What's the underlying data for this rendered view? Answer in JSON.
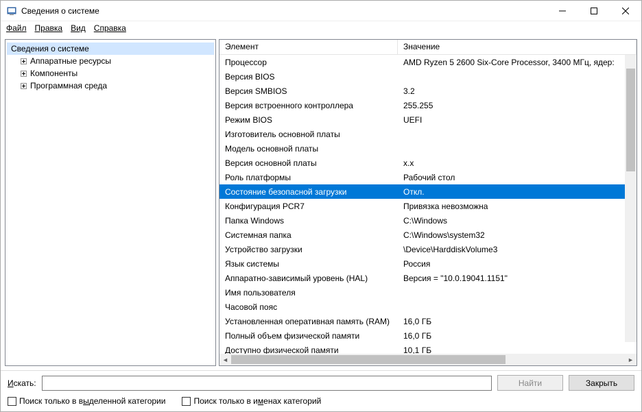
{
  "window": {
    "title": "Сведения о системе"
  },
  "menu": {
    "file": "Файл",
    "edit": "Правка",
    "view": "Вид",
    "help": "Справка"
  },
  "tree": {
    "root": "Сведения о системе",
    "items": [
      "Аппаратные ресурсы",
      "Компоненты",
      "Программная среда"
    ]
  },
  "list": {
    "header_element": "Элемент",
    "header_value": "Значение",
    "rows": [
      {
        "element": "Процессор",
        "value": "AMD Ryzen 5 2600 Six-Core Processor, 3400 МГц, ядер:"
      },
      {
        "element": "Версия BIOS",
        "value": ""
      },
      {
        "element": "Версия SMBIOS",
        "value": "3.2"
      },
      {
        "element": "Версия встроенного контроллера",
        "value": "255.255"
      },
      {
        "element": "Режим BIOS",
        "value": "UEFI"
      },
      {
        "element": "Изготовитель основной платы",
        "value": ""
      },
      {
        "element": "Модель основной платы",
        "value": ""
      },
      {
        "element": "Версия основной платы",
        "value": "х.х"
      },
      {
        "element": "Роль платформы",
        "value": "Рабочий стол"
      },
      {
        "element": "Состояние безопасной загрузки",
        "value": "Откл.",
        "selected": true
      },
      {
        "element": "Конфигурация PCR7",
        "value": "Привязка невозможна"
      },
      {
        "element": "Папка Windows",
        "value": "C:\\Windows"
      },
      {
        "element": "Системная папка",
        "value": "C:\\Windows\\system32"
      },
      {
        "element": "Устройство загрузки",
        "value": "\\Device\\HarddiskVolume3"
      },
      {
        "element": "Язык системы",
        "value": "Россия"
      },
      {
        "element": "Аппаратно-зависимый уровень (HAL)",
        "value": "Версия = \"10.0.19041.1151\""
      },
      {
        "element": "Имя пользователя",
        "value": ""
      },
      {
        "element": "Часовой пояс",
        "value": ""
      },
      {
        "element": "Установленная оперативная память (RAM)",
        "value": "16,0 ГБ"
      },
      {
        "element": "Полный объем физической памяти",
        "value": "16,0 ГБ"
      },
      {
        "element": "Доступно физической памяти",
        "value": "10,1 ГБ"
      }
    ]
  },
  "bottom": {
    "search_label": "Искать:",
    "find_button": "Найти",
    "close_button": "Закрыть",
    "check_selected_category": "Поиск только в выделенной категории",
    "check_category_names": "Поиск только в именах категорий"
  }
}
